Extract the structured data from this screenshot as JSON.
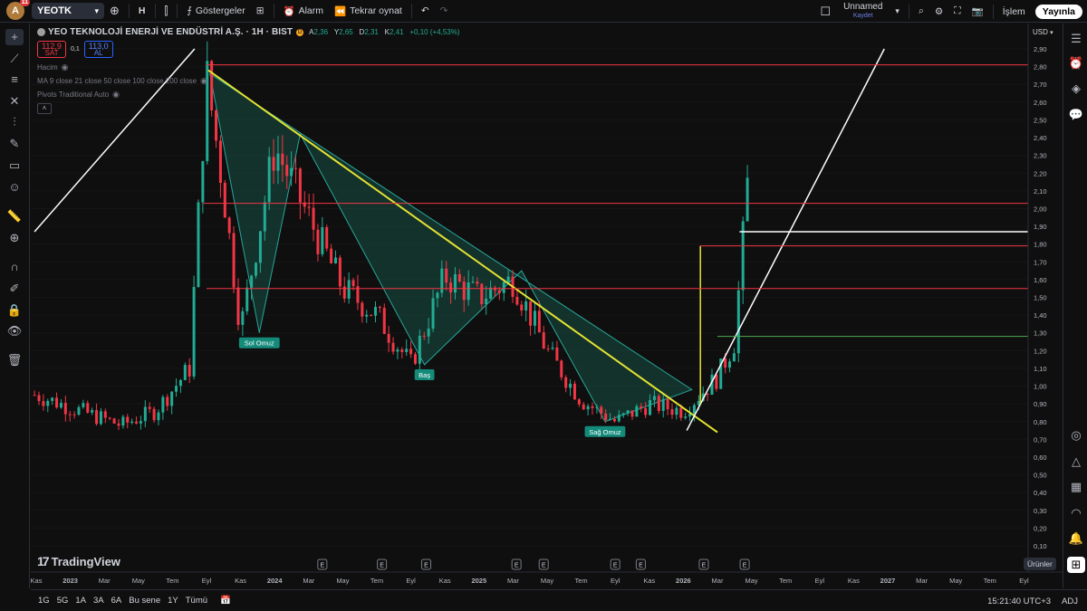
{
  "toolbar": {
    "avatar_letter": "A",
    "notification_count": "11",
    "symbol": "YEOTK",
    "interval": "H",
    "indicators_label": "Göstergeler",
    "alert_label": "Alarm",
    "replay_label": "Tekrar oynat",
    "layout_name": "Unnamed",
    "layout_status": "Kaydet",
    "trade_label": "İşlem",
    "publish_label": "Yayınla"
  },
  "legend": {
    "title": "YEO TEKNOLOJİ ENERJİ VE ENDÜSTRİ A.Ş. · 1H · BIST",
    "badge": "D",
    "open_label": "A",
    "open": "2,36",
    "high_label": "Y",
    "high": "2,65",
    "low_label": "D",
    "low": "2,31",
    "close_label": "K",
    "close": "2,41",
    "change": "+0,10 (+4,53%)",
    "sell_price": "112,9",
    "sell_label": "SAT",
    "spread": "0,1",
    "buy_price": "113,0",
    "buy_label": "AL",
    "indicator_volume": "Hacim",
    "indicator_ma": "MA 9 close 21 close 50 close 100 close 200 close",
    "indicator_pivots": "Pivots Traditional Auto"
  },
  "branding": "TradingView",
  "currency": "USD",
  "products_label": "Ürünler",
  "bottombar": {
    "ranges": [
      "1G",
      "5G",
      "1A",
      "3A",
      "6A",
      "Bu sene",
      "1Y",
      "Tümü"
    ],
    "time": "15:21:40 UTC+3",
    "adj": "ADJ"
  },
  "colors": {
    "up": "#22ab94",
    "down": "#f23645",
    "resistance": "#f23645",
    "support": "#4caf50",
    "trendline": "#e3e332",
    "triangle_fill": "#1b5e4f"
  },
  "chart_data": {
    "type": "candlestick",
    "y_axis_ticks": [
      "2,90",
      "2,80",
      "2,70",
      "2,60",
      "2,50",
      "2,40",
      "2,30",
      "2,20",
      "2,10",
      "2,00",
      "1,90",
      "1,80",
      "1,70",
      "1,60",
      "1,50",
      "1,40",
      "1,30",
      "1,20",
      "1,10",
      "1,00",
      "0,90",
      "0,80",
      "0,70",
      "0,60",
      "0,50",
      "0,40",
      "0,30",
      "0,20",
      "0,10"
    ],
    "ylim": [
      0.05,
      2.97
    ],
    "x_axis_ticks": [
      "Kas",
      "2023",
      "Mar",
      "May",
      "Tem",
      "Eyl",
      "Kas",
      "2024",
      "Mar",
      "May",
      "Tem",
      "Eyl",
      "Kas",
      "2025",
      "Mar",
      "May",
      "Tem",
      "Eyl",
      "Kas",
      "2026",
      "Mar",
      "May",
      "Tem",
      "Eyl",
      "Kas",
      "2027",
      "Mar",
      "May",
      "Tem",
      "Eyl"
    ],
    "horizontal_levels": [
      {
        "value": 2.81,
        "label": "2,81",
        "kind": "resistance"
      },
      {
        "value": 2.03,
        "label": "2,03",
        "kind": "resistance"
      },
      {
        "value": 1.87,
        "label": "1,87",
        "kind": "marker"
      },
      {
        "value": 1.79,
        "label": "1,79",
        "kind": "resistance"
      },
      {
        "value": 1.55,
        "label": "1,55",
        "kind": "resistance"
      },
      {
        "value": 1.28,
        "label": "1,28",
        "kind": "support"
      }
    ],
    "pattern_labels": [
      "Sol Omuz",
      "Baş",
      "Sağ Omuz"
    ],
    "event_markers": [
      "E",
      "E",
      "E",
      "E",
      "E",
      "E",
      "E",
      "E",
      "E"
    ],
    "price_series": [
      {
        "date": "2022-11",
        "close": 0.95
      },
      {
        "date": "2023-01",
        "close": 0.88
      },
      {
        "date": "2023-04",
        "close": 0.78
      },
      {
        "date": "2023-06",
        "close": 0.86
      },
      {
        "date": "2023-08",
        "close": 1.1
      },
      {
        "date": "2023-09",
        "close": 2.75
      },
      {
        "date": "2023-10",
        "close": 2.1
      },
      {
        "date": "2023-11",
        "close": 1.32
      },
      {
        "date": "2024-01",
        "close": 2.35
      },
      {
        "date": "2024-03",
        "close": 1.95
      },
      {
        "date": "2024-05",
        "close": 1.55
      },
      {
        "date": "2024-07",
        "close": 1.4
      },
      {
        "date": "2024-09",
        "close": 1.12
      },
      {
        "date": "2024-11",
        "close": 1.62
      },
      {
        "date": "2025-01",
        "close": 1.5
      },
      {
        "date": "2025-03",
        "close": 1.6
      },
      {
        "date": "2025-05",
        "close": 1.2
      },
      {
        "date": "2025-07",
        "close": 0.92
      },
      {
        "date": "2025-09",
        "close": 0.8
      },
      {
        "date": "2025-11",
        "close": 0.9
      },
      {
        "date": "2026-01",
        "close": 0.86
      },
      {
        "date": "2026-03",
        "close": 1.05
      },
      {
        "date": "2026-04",
        "close": 1.25
      },
      {
        "date": "2026-05",
        "close": 2.41
      }
    ]
  }
}
